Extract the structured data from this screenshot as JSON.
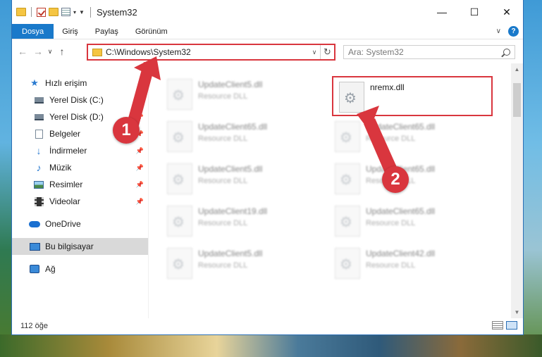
{
  "window": {
    "title": "System32"
  },
  "controls": {
    "minimize": "—",
    "maximize": "☐",
    "close": "✕"
  },
  "ribbon": {
    "tabs": [
      "Dosya",
      "Giriş",
      "Paylaş",
      "Görünüm"
    ]
  },
  "address": {
    "path": "C:\\Windows\\System32",
    "search_placeholder": "Ara: System32"
  },
  "sidebar": {
    "items": [
      {
        "label": "Hızlı erişim",
        "icon": "star-icon"
      },
      {
        "label": "Yerel Disk (C:)",
        "icon": "disk-icon",
        "pinned": true
      },
      {
        "label": "Yerel Disk (D:)",
        "icon": "disk-icon",
        "pinned": true
      },
      {
        "label": "Belgeler",
        "icon": "document-icon",
        "pinned": true
      },
      {
        "label": "İndirmeler",
        "icon": "download-icon",
        "pinned": true
      },
      {
        "label": "Müzik",
        "icon": "music-icon",
        "pinned": true
      },
      {
        "label": "Resimler",
        "icon": "picture-icon",
        "pinned": true
      },
      {
        "label": "Videolar",
        "icon": "video-icon",
        "pinned": true
      },
      {
        "label": "OneDrive",
        "icon": "cloud-icon"
      },
      {
        "label": "Bu bilgisayar",
        "icon": "computer-icon",
        "selected": true
      },
      {
        "label": "Ağ",
        "icon": "network-icon"
      }
    ]
  },
  "files": {
    "highlighted": {
      "name": "nremx.dll",
      "type": ""
    },
    "left_column": [
      {
        "name": "UpdateClient5.dll",
        "type": "Resource DLL"
      },
      {
        "name": "UpdateClient65.dll",
        "type": "Resource DLL"
      },
      {
        "name": "UpdateClient5.dll",
        "type": "Resource DLL"
      },
      {
        "name": "UpdateClient19.dll",
        "type": "Resource DLL"
      },
      {
        "name": "UpdateClient5.dll",
        "type": "Resource DLL"
      }
    ],
    "right_column": [
      {
        "name": "UpdateClient65.dll",
        "type": "Resource DLL"
      },
      {
        "name": "UpdateClient65.dll",
        "type": "Resource DLL"
      },
      {
        "name": "UpdateClient65.dll",
        "type": "Resource DLL"
      },
      {
        "name": "UpdateClient42.dll",
        "type": "Resource DLL"
      }
    ]
  },
  "status": {
    "count": "112 öğe"
  },
  "annotations": {
    "step1": "1",
    "step2": "2",
    "color": "#d9363e"
  }
}
